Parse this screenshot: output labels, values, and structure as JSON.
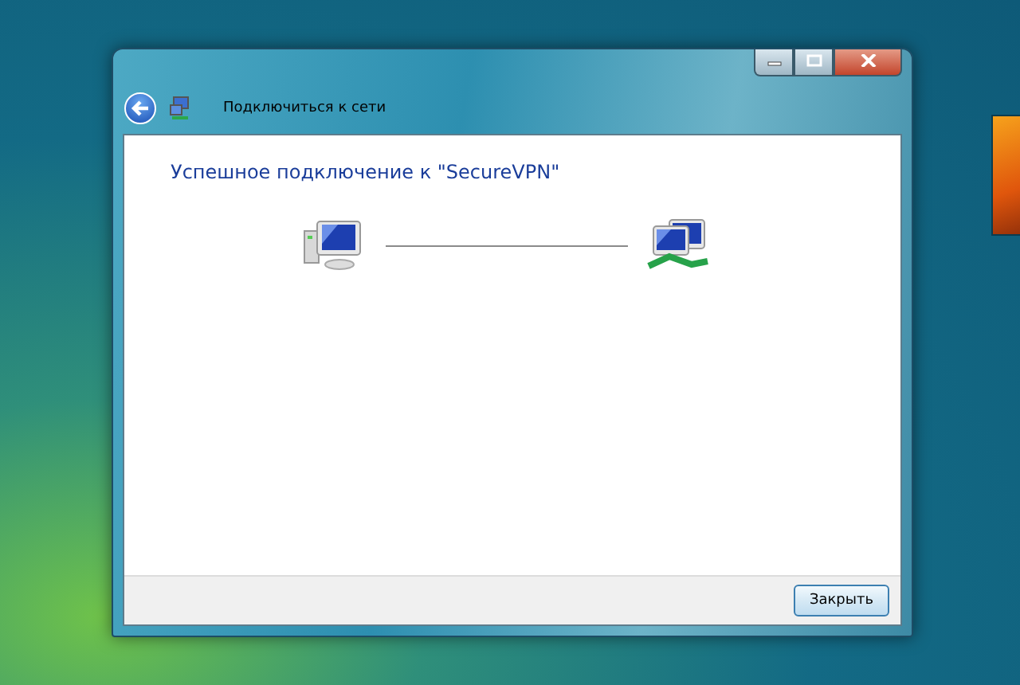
{
  "window": {
    "title": "Подключиться к сети"
  },
  "heading": "Успешное подключение к \"SecureVPN\"",
  "buttons": [
    {
      "label": "Закрыть"
    }
  ]
}
